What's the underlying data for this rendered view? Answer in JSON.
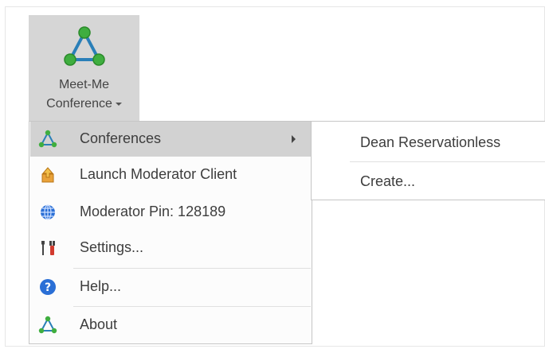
{
  "ribbon": {
    "button_line1": "Meet-Me",
    "button_line2": "Conference",
    "button_icon": "triangle-network-icon"
  },
  "menu": {
    "items": [
      {
        "label": "Conferences",
        "icon": "triangle-network-icon",
        "has_submenu": true
      },
      {
        "label": "Launch Moderator Client",
        "icon": "launch-upload-icon"
      },
      {
        "label": "Moderator Pin: 128189",
        "icon": "globe-icon"
      },
      {
        "label": "Settings...",
        "icon": "tools-icon"
      },
      {
        "label": "Help...",
        "icon": "help-icon"
      },
      {
        "label": "About",
        "icon": "triangle-network-icon"
      }
    ]
  },
  "submenu": {
    "items": [
      {
        "label": "Dean Reservationless"
      },
      {
        "label": "Create..."
      }
    ]
  },
  "colors": {
    "accent_green": "#2f9b3b",
    "accent_blue": "#2a6fd6",
    "highlight": "#d2d2d2"
  }
}
